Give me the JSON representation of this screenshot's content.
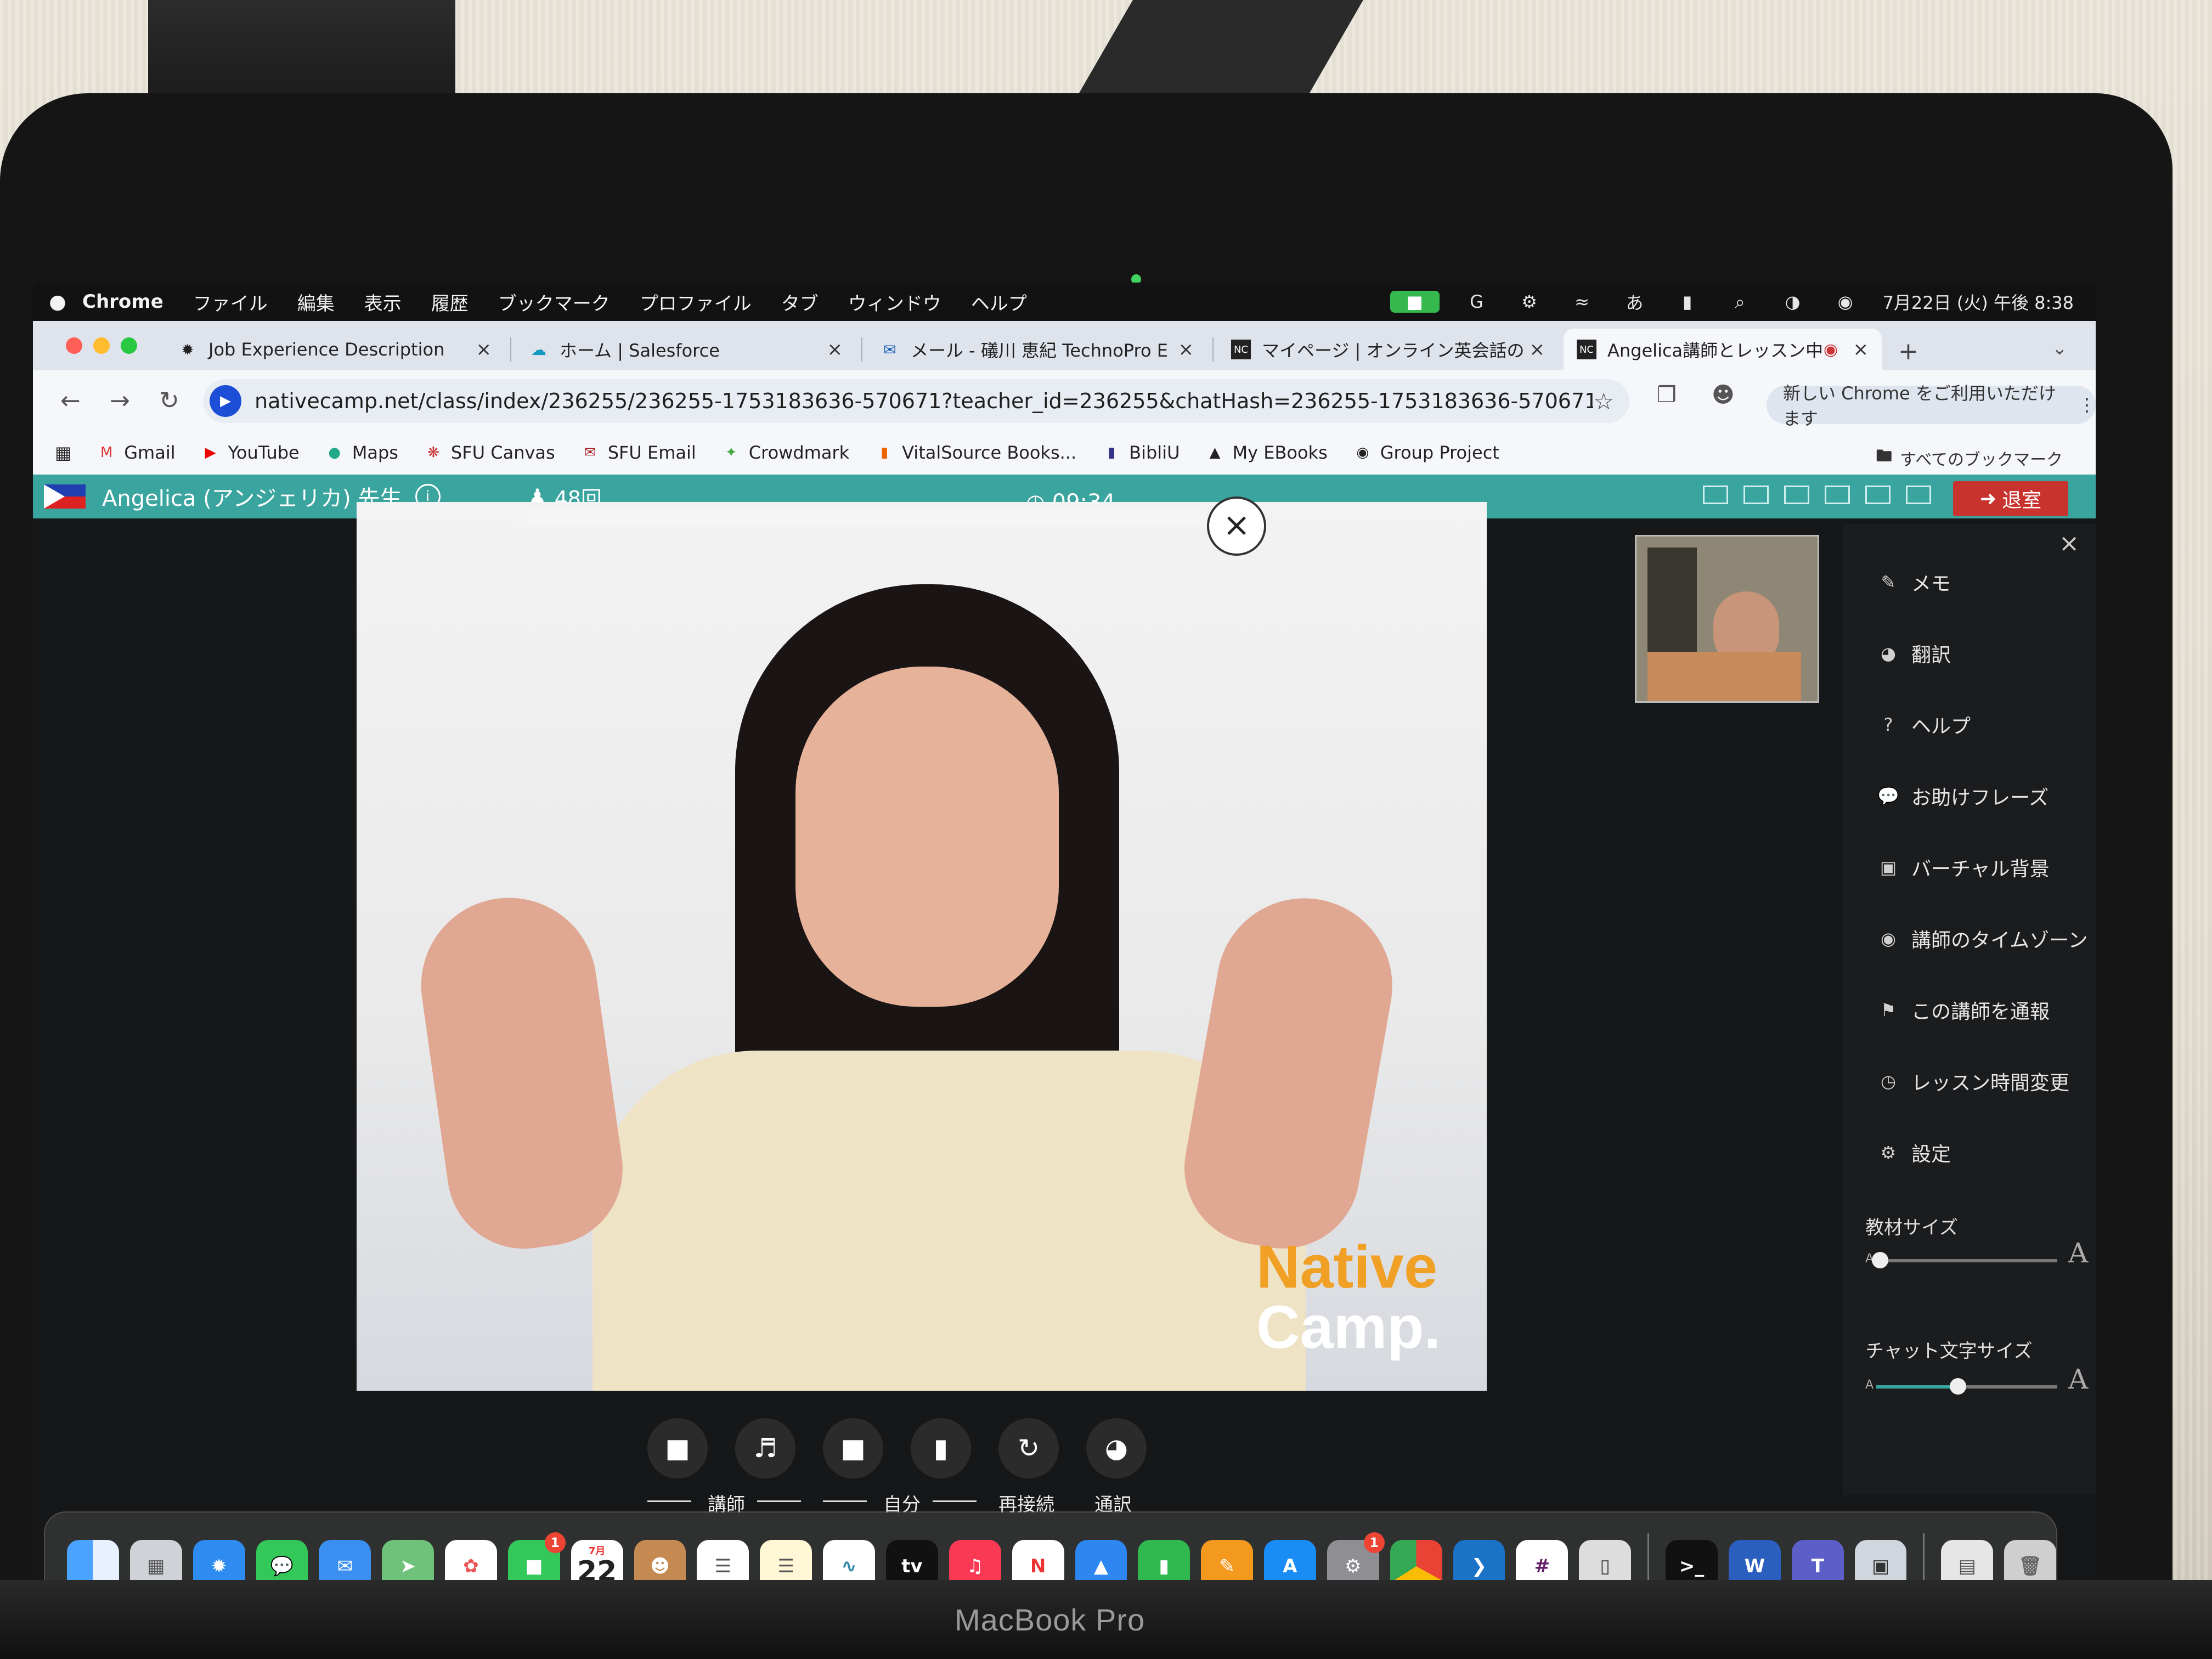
{
  "menubar": {
    "apple": "",
    "items": [
      "Chrome",
      "ファイル",
      "編集",
      "表示",
      "履歴",
      "ブックマーク",
      "プロファイル",
      "タブ",
      "ウィンドウ",
      "ヘルプ"
    ],
    "clock": "7月22日 (火) 午後 8:38",
    "input_mode": "あ"
  },
  "tabs": [
    {
      "title": "Job Experience Description",
      "icon": "openai-icon"
    },
    {
      "title": "ホーム | Salesforce",
      "icon": "salesforce-cloud-icon"
    },
    {
      "title": "メール - 礒川 恵紀 TechnoPro E",
      "icon": "outlook-icon"
    },
    {
      "title": "マイページ | オンライン英会話の",
      "icon": "nc-icon"
    },
    {
      "title": "Angelica講師とレッスン中",
      "icon": "nc-icon",
      "active": true
    }
  ],
  "omnibox": {
    "url": "nativecamp.net/class/index/236255/236255-1753183636-570671?teacher_id=236255&chatHash=236255-1753183636-570671"
  },
  "update_notice": "新しい Chrome をご利用いただけます",
  "bookmarks": [
    "Gmail",
    "YouTube",
    "Maps",
    "SFU Canvas",
    "SFU Email",
    "Crowdmark",
    "VitalSource Books...",
    "BibliU",
    "My EBooks",
    "Group Project"
  ],
  "all_bookmarks": "すべてのブックマーク",
  "lesson": {
    "teacher_name": "Angelica (アンジェリカ) 先生",
    "count": "48回",
    "timer": "09:34",
    "exit_label": "退室",
    "watermark_line1": "Native",
    "watermark_line2": "Camp."
  },
  "side_menu": [
    {
      "label": "メモ",
      "icon": "edit-icon"
    },
    {
      "label": "翻訳",
      "icon": "globe-icon"
    },
    {
      "label": "ヘルプ",
      "icon": "question-icon"
    },
    {
      "label": "お助けフレーズ",
      "icon": "chat-bubble-icon"
    },
    {
      "label": "バーチャル背景",
      "icon": "image-icon"
    },
    {
      "label": "講師のタイムゾーン",
      "icon": "world-clock-icon"
    },
    {
      "label": "この講師を通報",
      "icon": "flag-icon"
    },
    {
      "label": "レッスン時間変更",
      "icon": "clock-icon"
    },
    {
      "label": "設定",
      "icon": "gear-icon"
    }
  ],
  "sliders": {
    "material_size": {
      "label": "教材サイズ",
      "value": 0.02
    },
    "chat_text_size": {
      "label": "チャット文字サイズ",
      "value": 0.45
    },
    "small_a": "A",
    "big_a": "A"
  },
  "controls": {
    "teacher_label": "講師",
    "self_label": "自分",
    "reconnect_label": "再接続",
    "interpret_label": "通訳"
  },
  "dock": {
    "calendar_month": "7月",
    "calendar_day": "22",
    "facetime_badge": "1",
    "settings_badge": "1",
    "appletv_label": "tv"
  },
  "laptop_brand": "MacBook Pro",
  "colors": {
    "nc_teal": "#3aa49f",
    "exit_red": "#c8332d",
    "brand_orange": "#f0a024"
  }
}
